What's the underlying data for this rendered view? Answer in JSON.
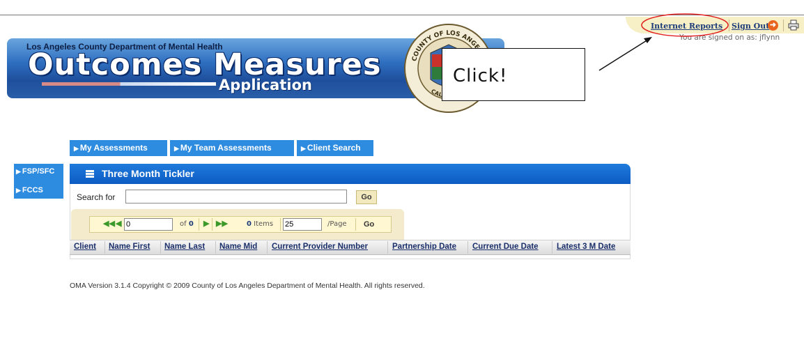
{
  "utility": {
    "internet_reports": "Internet Reports",
    "sign_out": "Sign Out",
    "signed_on": "You are signed on as: jflynn"
  },
  "banner": {
    "department": "Los Angeles County Department of Mental Health",
    "title": "Outcomes Measures",
    "subtitle": "Application",
    "seal_text_top": "COUNTY OF LOS ANGELES",
    "seal_text_bottom": "CALIFORNIA"
  },
  "annotation": {
    "callout_text": "Click!"
  },
  "tabs": [
    {
      "label": "My Assessments"
    },
    {
      "label": "My Team Assessments"
    },
    {
      "label": "Client Search"
    }
  ],
  "leftnav": [
    {
      "label": "FSP/SFC"
    },
    {
      "label": "FCCS"
    }
  ],
  "panel": {
    "title": "Three Month Tickler",
    "search_label": "Search for",
    "search_value": "",
    "go_label": "Go"
  },
  "pager": {
    "page_value": "0",
    "of_text": "of",
    "total_pages": "0",
    "items_count": "0",
    "items_label": "Items",
    "page_size": "25",
    "per_page_label": "/Page",
    "go_label": "Go"
  },
  "table": {
    "columns": [
      "Client",
      "Name First",
      "Name Last",
      "Name Mid",
      "Current Provider Number",
      "Partnership Date",
      "Current Due Date",
      "Latest 3 M Date"
    ]
  },
  "footer": {
    "text": "OMA Version 3.1.4 Copyright © 2009 County of Los Angeles Department of Mental Health. All rights reserved."
  },
  "colors": {
    "tab_blue": "#2d8be0",
    "panel_blue": "#0c5bc4",
    "highlight_red": "#e0201e",
    "pager_bg": "#f3ebcb"
  }
}
